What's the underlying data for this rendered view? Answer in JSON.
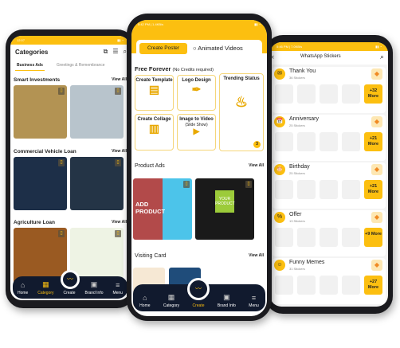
{
  "colors": {
    "accent": "#fcbf10",
    "nav": "#111a2e"
  },
  "left": {
    "status_time": "12:07",
    "title": "Categories",
    "tabs": [
      "Business Ads",
      "Greetings & Remembrance"
    ],
    "sections": [
      {
        "title": "Smart Investments",
        "view_all": "View All"
      },
      {
        "title": "Commercial Vehicle Loan",
        "view_all": "View All"
      },
      {
        "title": "Agriculture Loan",
        "view_all": "View All"
      }
    ],
    "nav": [
      "Home",
      "Category",
      "Create",
      "Brand Info",
      "Menu"
    ]
  },
  "center": {
    "status_text": "5:42 PM | 1.4KB/s",
    "toggle": {
      "create_poster": "Create Poster",
      "animated_videos": "Animated Videos"
    },
    "free_title": "Free Forever",
    "free_sub": "(No Credits required)",
    "tiles": [
      "Create Template",
      "Logo Design",
      "Trending Status",
      "Create Collage",
      "Image to Video",
      "(Slide Show)"
    ],
    "trending_badge": "3",
    "product_ads": "Product Ads",
    "visiting_card": "Visiting Card",
    "view_all": "View All",
    "add_product": "ADD PRODUCT",
    "your_product": "YOUR PRODUCT",
    "nav": [
      "Home",
      "Category",
      "Create",
      "Brand Info",
      "Menu"
    ]
  },
  "right": {
    "status_text": "5:46 PM | 7.0KB/s",
    "title": "WhatsApp Stickers",
    "categories": [
      {
        "name": "Thank You",
        "count": "36 Stickers",
        "more": "+32 More"
      },
      {
        "name": "Anniversary",
        "count": "25 Stickers",
        "more": "+21 More"
      },
      {
        "name": "Birthday",
        "count": "25 Stickers",
        "more": "+21 More"
      },
      {
        "name": "Offer",
        "count": "13 Stickers",
        "more": "+9 More"
      },
      {
        "name": "Funny Memes",
        "count": "31 Stickers",
        "more": "+27 More"
      }
    ]
  }
}
